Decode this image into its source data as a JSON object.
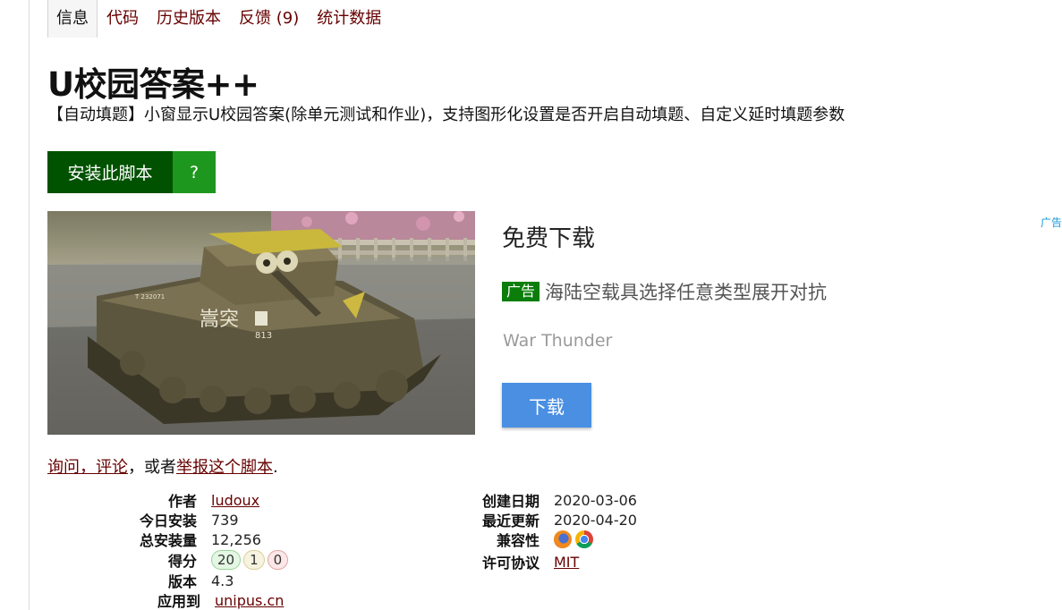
{
  "tabs": [
    {
      "label": "信息",
      "active": true
    },
    {
      "label": "代码",
      "active": false
    },
    {
      "label": "历史版本",
      "active": false
    },
    {
      "label": "反馈 (9)",
      "active": false
    },
    {
      "label": "统计数据",
      "active": false
    }
  ],
  "script": {
    "title": "U校园答案++",
    "description": "【自动填题】小窗显示U校园答案(除单元测试和作业)，支持图形化设置是否开启自动填题、自定义延时填题参数"
  },
  "install": {
    "label": "安装此脚本",
    "help_label": "?"
  },
  "ad": {
    "corner_label": "广告",
    "headline": "免费下载",
    "badge": "广告",
    "tagline": "海陆空载具选择任意类型展开对抗",
    "brand": "War Thunder",
    "download_label": "下载",
    "image_text": [
      "嵩突",
      "813",
      "T 232071"
    ]
  },
  "feedback": {
    "ask_link": "询问，评论",
    "middle": "，或者",
    "report_link": "举报这个脚本",
    "end": "."
  },
  "info_left": {
    "author_label": "作者",
    "author": "ludoux",
    "daily_label": "今日安装",
    "daily": "739",
    "total_label": "总安装量",
    "total": "12,256",
    "rating_label": "得分",
    "rating_good": "20",
    "rating_ok": "1",
    "rating_bad": "0",
    "version_label": "版本",
    "version": "4.3",
    "applies_label": "应用到",
    "applies": "unipus.cn"
  },
  "info_right": {
    "created_label": "创建日期",
    "created": "2020-03-06",
    "updated_label": "最近更新",
    "updated": "2020-04-20",
    "compat_label": "兼容性",
    "compat_icons": [
      "firefox-icon",
      "chrome-icon"
    ],
    "license_label": "许可协议",
    "license": "MIT"
  },
  "colors": {
    "link": "#670000",
    "install_dark": "#005200",
    "install_light": "#1e971e",
    "ad_button": "#4a8fe2"
  }
}
